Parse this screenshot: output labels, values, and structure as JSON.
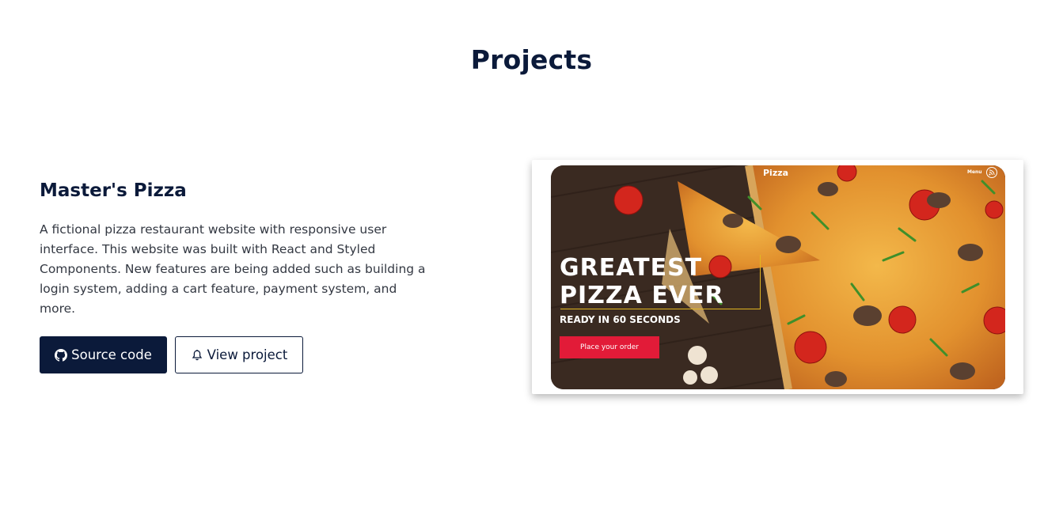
{
  "section": {
    "title": "Projects"
  },
  "project": {
    "title": "Master's Pizza",
    "description": "A fictional pizza restaurant website with responsive user interface. This website was built with React and Styled Components. New features are being added such as building a login system, adding a cart feature, payment system, and more.",
    "source_label": "Source code",
    "view_label": "View project",
    "source_icon": "github-icon",
    "view_icon": "bell-icon"
  },
  "preview": {
    "brand": "Pizza",
    "menu_label": "Menu",
    "menu_icon": "rss-icon",
    "headline_1": "GREATEST",
    "headline_2": "PIZZA EVER",
    "subheadline": "READY IN 60 SECONDS",
    "cta_label": "Place your order",
    "colors": {
      "cta": "#e21b38",
      "accent_line": "#e2b622"
    }
  },
  "theme": {
    "primary": "#0b1a3a"
  }
}
